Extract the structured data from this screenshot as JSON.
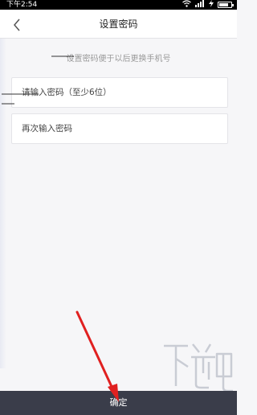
{
  "status_bar": {
    "time": "下午2:54",
    "icons": [
      "wifi-icon",
      "signal-icon",
      "charging-icon",
      "battery-icon"
    ]
  },
  "nav": {
    "title": "设置密码",
    "back_icon": "chevron-left-icon"
  },
  "hint": "设置密码便于以后更换手机号",
  "form": {
    "password_placeholder": "请输入密码（至少6位）",
    "confirm_placeholder": "再次输入密码"
  },
  "confirm_button": "确定",
  "watermark": {
    "text": "下载吧"
  },
  "colors": {
    "annotation_arrow": "#e02020",
    "confirm_bar": "#3a3d4a",
    "background": "#f6f6f8"
  }
}
